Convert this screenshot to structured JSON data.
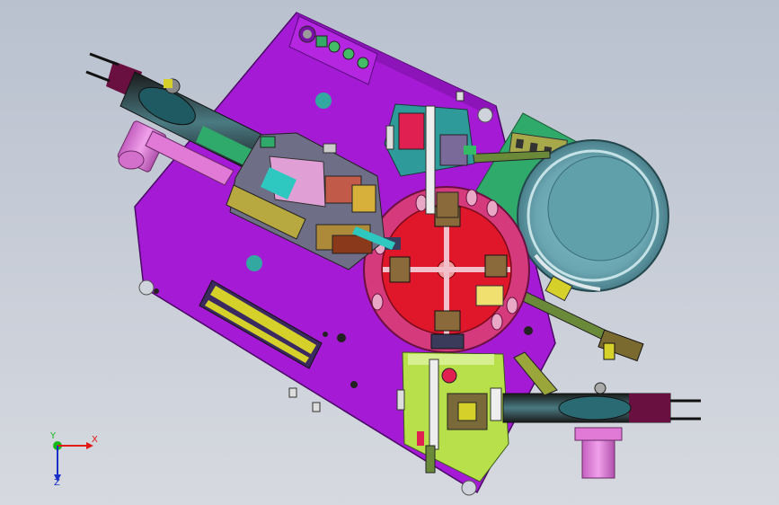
{
  "view": {
    "name": "3D CAD top view",
    "background_top": "#b9c1cf",
    "background_bottom": "#d6d9df"
  },
  "colors": {
    "base_plate": "#a51ad4",
    "base_plate_dark": "#7a10a0",
    "rotary_table": "#e0162b",
    "rotary_ring": "#d43a7c",
    "feeder_bowl": "#7aa8b4",
    "feeder_bowl_inner": "#5e9aa6",
    "feeder_base": "#2faa6a",
    "olive": "#9aa53a",
    "yellow_part": "#d6d12a",
    "lime_block": "#b8e04a",
    "teal_block": "#2e9a9a",
    "pink_motor": "#e07ad6",
    "dark_maroon": "#6a1040"
  },
  "triad": {
    "x_label": "X",
    "y_label": "Y",
    "z_label": "Z",
    "x_color": "#e01818",
    "y_color": "#18b818",
    "z_color": "#1830c8"
  }
}
